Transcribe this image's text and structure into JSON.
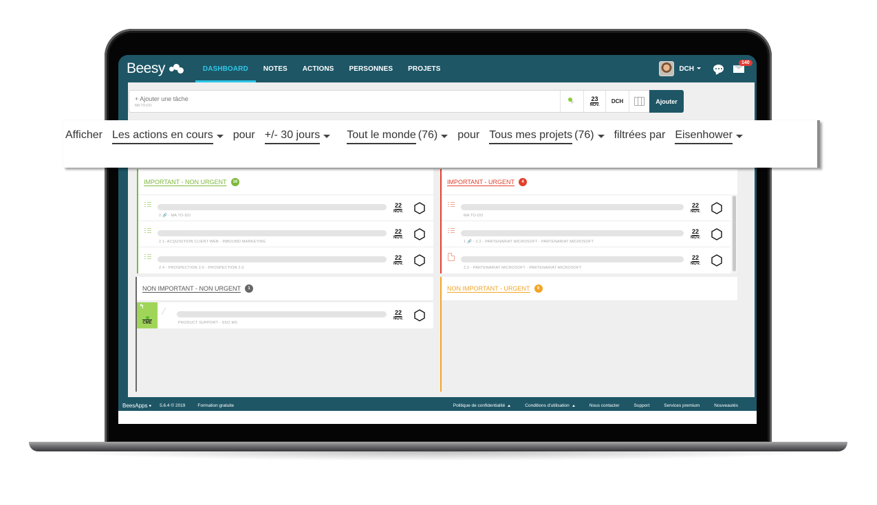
{
  "app": {
    "brand": "Beesy",
    "nav": [
      {
        "label": "DASHBOARD",
        "active": true
      },
      {
        "label": "NOTES",
        "active": false
      },
      {
        "label": "ACTIONS",
        "active": false
      },
      {
        "label": "PERSONNES",
        "active": false
      },
      {
        "label": "PROJETS",
        "active": false
      }
    ],
    "user": {
      "initials": "DCH"
    },
    "notifications": {
      "mail_count": "140"
    }
  },
  "add_task": {
    "placeholder": "+ Ajouter une tâche",
    "context": "MA TO-DO",
    "date_day": "23",
    "date_month": "NOV.",
    "assignee": "DCH",
    "submit_label": "Ajouter"
  },
  "filters": {
    "show_label": "Afficher",
    "status": "Les actions en cours",
    "for_label_1": "pour",
    "period": "+/- 30 jours",
    "people": "Tout le monde",
    "people_count": "(76)",
    "for_label_2": "pour",
    "projects": "Tous mes projets",
    "projects_count": "(76)",
    "filtered_by_label": "filtrées par",
    "method": "Eisenhower"
  },
  "quadrants": {
    "important_non_urgent": {
      "title": "IMPORTANT - NON URGENT",
      "count": "16",
      "color": "#7db83a",
      "tasks": [
        {
          "icon": "checklist-icon",
          "meta": "2 🔗 - MA TO-DO",
          "day": "22",
          "month": "NOV."
        },
        {
          "icon": "checklist-icon",
          "meta": "2.1- ACQUISITION CLIENT WEB - INBOUND MARKETING",
          "day": "22",
          "month": "NOV."
        },
        {
          "icon": "checklist-icon",
          "meta": "2.4 - PROSPECTION 2.0 - PROSPECTION 2.0",
          "day": "22",
          "month": "NOV."
        }
      ]
    },
    "important_urgent": {
      "title": "IMPORTANT - URGENT",
      "count": "4",
      "color": "#e0402d",
      "tasks": [
        {
          "icon": "checklist-icon",
          "meta": "MA TO-DO",
          "day": "22",
          "month": "NOV."
        },
        {
          "icon": "checklist-icon",
          "meta": "1 🔗 - 2.2 - PARTENARIAT MICROSOFT - PARTENARIAT MICROSOFT",
          "day": "22",
          "month": "NOV."
        },
        {
          "icon": "document-icon",
          "meta": "2.2 - PARTENARIAT MICROSOFT - PARTENARIAT MICROSOFT",
          "day": "22",
          "month": "NOV."
        }
      ]
    },
    "non_important_non_urgent": {
      "title": "NON IMPORTANT - NON URGENT",
      "count": "1",
      "color": "#666666",
      "tasks": [
        {
          "icon": "pencil-icon",
          "badge": "CME",
          "meta": "PRODUCT SUPPORT - SSO MS",
          "day": "22",
          "month": "NOV."
        }
      ]
    },
    "non_important_urgent": {
      "title": "NON IMPORTANT - URGENT",
      "count": "0",
      "color": "#f3a526",
      "tasks": []
    }
  },
  "footer": {
    "brand": "BeesApps",
    "version": "5.6.4 © 2019",
    "training": "Formation gratuite",
    "links": [
      "Politique de confidentialité",
      "Conditions d'utilisation",
      "Nous contacter",
      "Support",
      "Services premium",
      "Nouveautés"
    ]
  }
}
